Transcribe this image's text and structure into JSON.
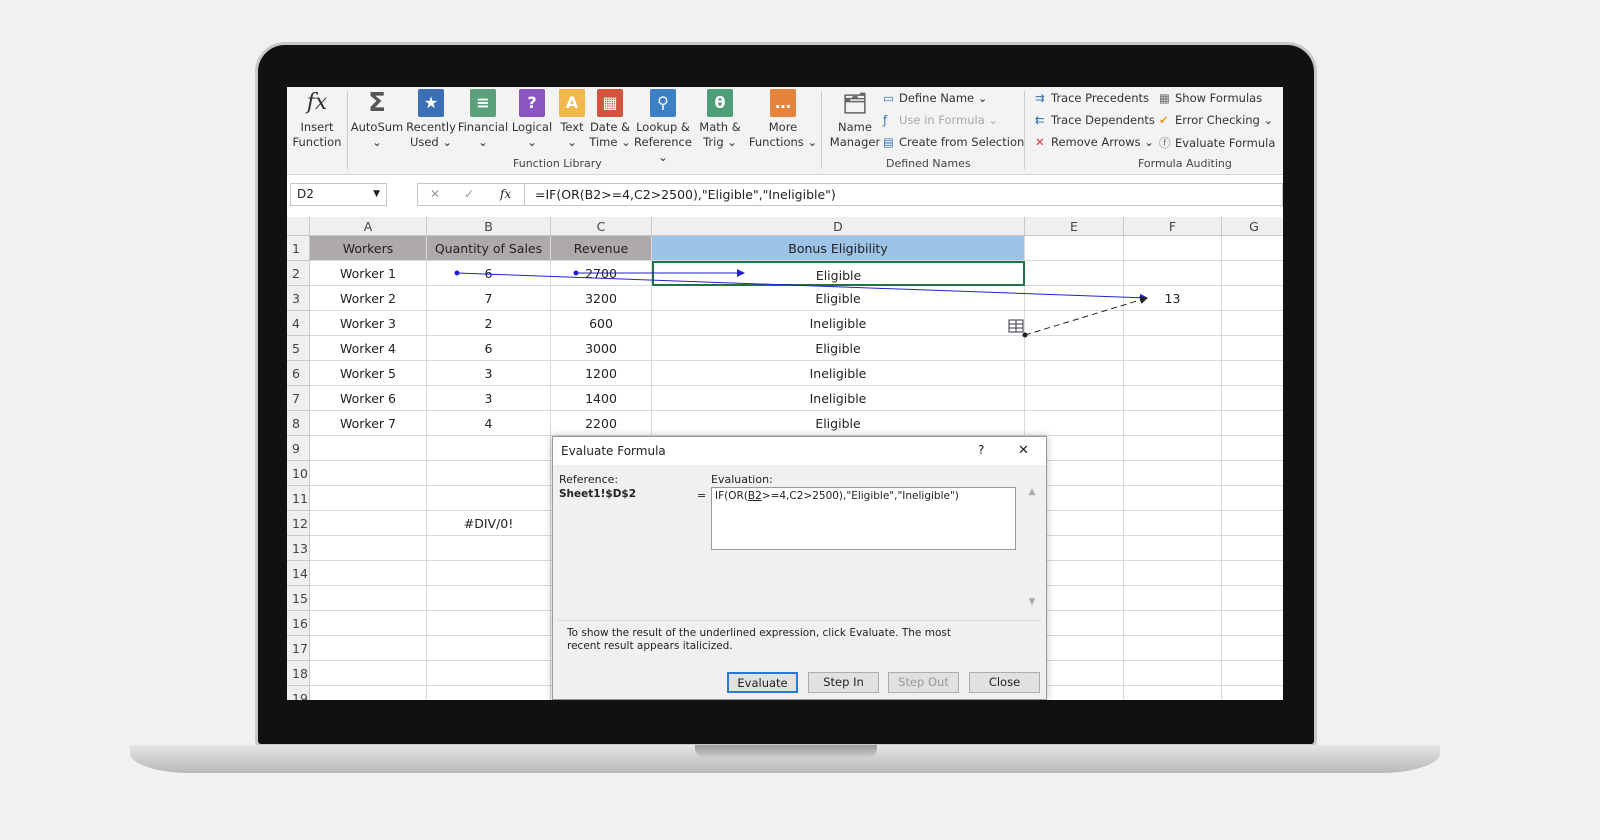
{
  "ribbon": {
    "insert_function": "Insert\nFunction",
    "buttons": [
      {
        "l1": "AutoSum",
        "l2": "⌄",
        "icon": "Σ",
        "color": "#555555"
      },
      {
        "l1": "Recently",
        "l2": "Used ⌄",
        "icon": "★",
        "color": "#3b6fb6"
      },
      {
        "l1": "Financial",
        "l2": "⌄",
        "icon": "≡",
        "color": "#5aa07a"
      },
      {
        "l1": "Logical",
        "l2": "⌄",
        "icon": "?",
        "color": "#8a55c2"
      },
      {
        "l1": "Text",
        "l2": "⌄",
        "icon": "A",
        "color": "#f0b84a"
      },
      {
        "l1": "Date &",
        "l2": "Time ⌄",
        "icon": "▦",
        "color": "#d4533d"
      },
      {
        "l1": "Lookup &",
        "l2": "Reference ⌄",
        "icon": "⚲",
        "color": "#3b7fc4"
      },
      {
        "l1": "Math &",
        "l2": "Trig ⌄",
        "icon": "θ",
        "color": "#4f9e7a"
      },
      {
        "l1": "More",
        "l2": "Functions ⌄",
        "icon": "…",
        "color": "#e5833a"
      }
    ],
    "function_library": "Function Library",
    "name_manager": "Name\nManager",
    "define_name": "Define Name  ⌄",
    "use_in_formula": "Use in Formula ⌄",
    "create_from_selection": "Create from Selection",
    "defined_names": "Defined Names",
    "trace_precedents": "Trace Precedents",
    "trace_dependents": "Trace Dependents",
    "remove_arrows": "Remove Arrows  ⌄",
    "show_formulas": "Show Formulas",
    "error_checking": "Error Checking  ⌄",
    "evaluate_formula": "Evaluate Formula",
    "formula_auditing": "Formula Auditing"
  },
  "formula_bar": {
    "name_box": "D2",
    "formula": "=IF(OR(B2>=4,C2>2500),\"Eligible\",\"Ineligible\")"
  },
  "sheet": {
    "columns": [
      "A",
      "B",
      "C",
      "D",
      "E",
      "F",
      "G"
    ],
    "rows": [
      [
        "Workers",
        "Quantity of Sales",
        "Revenue",
        "Bonus Eligibility",
        "",
        "",
        ""
      ],
      [
        "Worker 1",
        "6",
        "2700",
        "Eligible",
        "",
        "",
        ""
      ],
      [
        "Worker 2",
        "7",
        "3200",
        "Eligible",
        "",
        "13",
        ""
      ],
      [
        "Worker 3",
        "2",
        "600",
        "Ineligible",
        "",
        "",
        ""
      ],
      [
        "Worker 4",
        "6",
        "3000",
        "Eligible",
        "",
        "",
        ""
      ],
      [
        "Worker 5",
        "3",
        "1200",
        "Ineligible",
        "",
        "",
        ""
      ],
      [
        "Worker 6",
        "3",
        "1400",
        "Ineligible",
        "",
        "",
        ""
      ],
      [
        "Worker 7",
        "4",
        "2200",
        "Eligible",
        "",
        "",
        ""
      ],
      [
        "",
        "",
        "",
        "",
        "",
        "",
        ""
      ],
      [
        "",
        "",
        "",
        "",
        "",
        "",
        ""
      ],
      [
        "",
        "",
        "",
        "",
        "",
        "",
        ""
      ],
      [
        "",
        "#DIV/0!",
        "",
        "",
        "",
        "",
        ""
      ],
      [
        "",
        "",
        "",
        "",
        "",
        "",
        ""
      ],
      [
        "",
        "",
        "",
        "",
        "",
        "",
        ""
      ],
      [
        "",
        "",
        "",
        "",
        "",
        "",
        ""
      ],
      [
        "",
        "",
        "",
        "",
        "",
        "",
        ""
      ],
      [
        "",
        "",
        "",
        "",
        "",
        "",
        ""
      ],
      [
        "",
        "",
        "",
        "",
        "",
        "",
        ""
      ],
      [
        "",
        "",
        "",
        "",
        "",
        "",
        ""
      ]
    ],
    "header_colors": {
      "A": "#aeaaaa",
      "B": "#aeaaaa",
      "C": "#aeaaaa",
      "D": "#9dc3e6"
    }
  },
  "dialog": {
    "title": "Evaluate Formula",
    "help": "?",
    "close": "✕",
    "reference_label": "Reference:",
    "reference": "Sheet1!$D$2",
    "equals": "=",
    "evaluation_label": "Evaluation:",
    "eval_pre": "IF(OR(",
    "eval_underlined": "B2",
    "eval_post": ">=4,C2>2500),\"Eligible\",\"Ineligible\")",
    "hint": "To show the result of the underlined expression, click Evaluate.  The most recent result appears italicized.",
    "evaluate": "Evaluate",
    "step_in": "Step In",
    "step_out": "Step Out",
    "close_btn": "Close"
  }
}
